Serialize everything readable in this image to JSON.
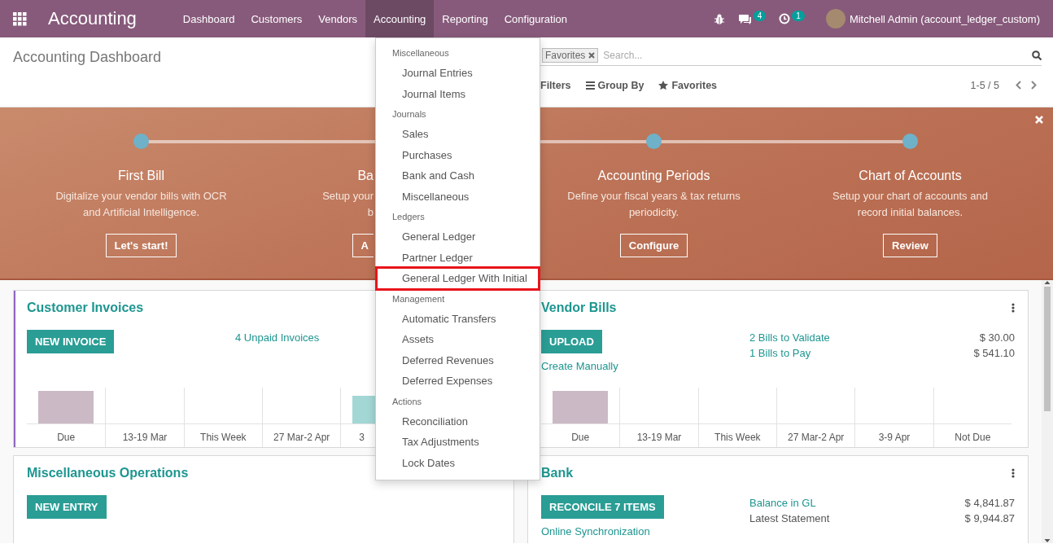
{
  "navbar": {
    "brand": "Accounting",
    "menu": [
      {
        "label": "Dashboard",
        "selected": false
      },
      {
        "label": "Customers",
        "selected": false
      },
      {
        "label": "Vendors",
        "selected": false
      },
      {
        "label": "Accounting",
        "selected": true
      },
      {
        "label": "Reporting",
        "selected": false
      },
      {
        "label": "Configuration",
        "selected": false
      }
    ],
    "messages_badge": "4",
    "activities_badge": "1",
    "user": "Mitchell Admin (account_ledger_custom)"
  },
  "control_panel": {
    "title": "Accounting Dashboard",
    "search": {
      "facet": "Favorites",
      "placeholder": "Search..."
    },
    "filters": [
      {
        "label": "Filters",
        "kind": "filter"
      },
      {
        "label": "Group By",
        "kind": "group"
      },
      {
        "label": "Favorites",
        "kind": "favorites"
      }
    ],
    "pager": "1-5 / 5"
  },
  "banner": {
    "steps": [
      {
        "title": "First Bill",
        "lines": [
          "Digitalize your vendor bills with OCR",
          "and Artificial Intelligence."
        ],
        "button": "Let's start!",
        "partial": false
      },
      {
        "title": "Ba",
        "lines": [
          "Setup your",
          "b"
        ],
        "button": "A",
        "partial": true
      },
      {
        "title": "Accounting Periods",
        "lines": [
          "Define your fiscal years & tax returns",
          "periodicity."
        ],
        "button": "Configure",
        "partial": false
      },
      {
        "title": "Chart of Accounts",
        "lines": [
          "Setup your chart of accounts and",
          "record initial balances."
        ],
        "button": "Review",
        "partial": false
      }
    ]
  },
  "cards": [
    {
      "title": "Customer Invoices",
      "highlighted": true,
      "button": "NEW INVOICE",
      "stats": [
        {
          "label": "4 Unpaid Invoices",
          "link": true
        }
      ],
      "chart": [
        {
          "label": "Due",
          "color": "#cbbac6",
          "partial": false
        },
        {
          "label": "13-19 Mar",
          "partial": false
        },
        {
          "label": "This Week",
          "partial": false
        },
        {
          "label": "27 Mar-2 Apr",
          "partial": false
        },
        {
          "label": "3",
          "color": "#a3d7d5",
          "partial": true
        }
      ]
    },
    {
      "title": "Vendor Bills",
      "highlighted": false,
      "menu": true,
      "button": "UPLOAD",
      "link": "Create Manually",
      "stats": [
        {
          "label": "2 Bills to Validate",
          "link": true,
          "value": "$ 30.00"
        },
        {
          "label": "1 Bills to Pay",
          "link": true,
          "value": "$ 541.10"
        }
      ],
      "chart": [
        {
          "label": "Due",
          "color": "#cbbac6",
          "partial": false
        },
        {
          "label": "13-19 Mar",
          "partial": false
        },
        {
          "label": "This Week",
          "partial": false
        },
        {
          "label": "27 Mar-2 Apr",
          "partial": false
        },
        {
          "label": "3-9 Apr",
          "partial": false
        },
        {
          "label": "Not Due",
          "partial": false
        }
      ]
    },
    {
      "title": "Miscellaneous Operations",
      "highlighted": false,
      "button": "NEW ENTRY"
    },
    {
      "title": "Bank",
      "highlighted": false,
      "menu": true,
      "button": "RECONCILE 7 ITEMS",
      "link": "Online Synchronization",
      "stats": [
        {
          "label": "Balance in GL",
          "link": true,
          "value": "$ 4,841.87"
        },
        {
          "label": "Latest Statement",
          "link": false,
          "value": "$ 9,944.87"
        }
      ]
    }
  ],
  "dropdown": {
    "sections": [
      {
        "header": "Miscellaneous",
        "items": [
          {
            "label": "Journal Entries",
            "highlighted": false
          },
          {
            "label": "Journal Items",
            "highlighted": false
          }
        ]
      },
      {
        "header": "Journals",
        "items": [
          {
            "label": "Sales",
            "highlighted": false
          },
          {
            "label": "Purchases",
            "highlighted": false
          },
          {
            "label": "Bank and Cash",
            "highlighted": false
          },
          {
            "label": "Miscellaneous",
            "highlighted": false
          }
        ]
      },
      {
        "header": "Ledgers",
        "items": [
          {
            "label": "General Ledger",
            "highlighted": false
          },
          {
            "label": "Partner Ledger",
            "highlighted": false
          },
          {
            "label": "General Ledger With Initial",
            "highlighted": true
          }
        ]
      },
      {
        "header": "Management",
        "items": [
          {
            "label": "Automatic Transfers",
            "highlighted": false
          },
          {
            "label": "Assets",
            "highlighted": false
          },
          {
            "label": "Deferred Revenues",
            "highlighted": false
          },
          {
            "label": "Deferred Expenses",
            "highlighted": false
          }
        ]
      },
      {
        "header": "Actions",
        "items": [
          {
            "label": "Reconciliation",
            "highlighted": false
          },
          {
            "label": "Tax Adjustments",
            "highlighted": false
          },
          {
            "label": "Lock Dates",
            "highlighted": false
          }
        ]
      }
    ]
  }
}
